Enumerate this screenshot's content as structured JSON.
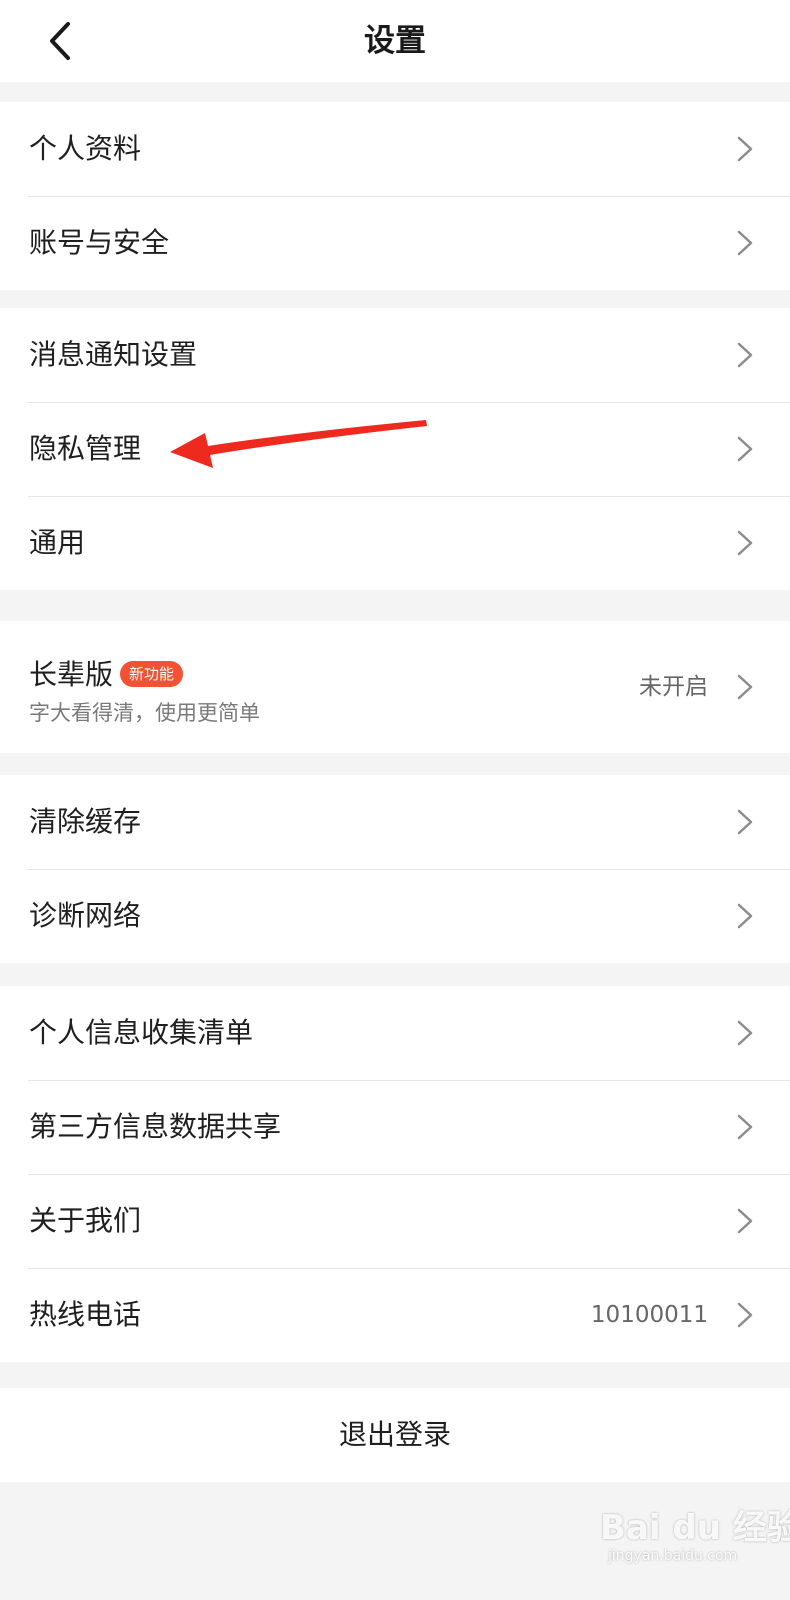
{
  "header": {
    "title": "设置",
    "back_icon": "chevron-left-icon"
  },
  "groups": [
    {
      "items": [
        {
          "label": "个人资料"
        },
        {
          "label": "账号与安全"
        }
      ]
    },
    {
      "items": [
        {
          "label": "消息通知设置"
        },
        {
          "label": "隐私管理"
        },
        {
          "label": "通用"
        }
      ]
    },
    {
      "elder": {
        "title": "长辈版",
        "badge": "新功能",
        "subtitle": "字大看得清，使用更简单",
        "value": "未开启"
      }
    },
    {
      "items": [
        {
          "label": "清除缓存"
        },
        {
          "label": "诊断网络"
        }
      ]
    },
    {
      "items": [
        {
          "label": "个人信息收集清单"
        },
        {
          "label": "第三方信息数据共享"
        },
        {
          "label": "关于我们"
        },
        {
          "label": "热线电话",
          "value": "10100011"
        }
      ]
    }
  ],
  "logout_label": "退出登录",
  "colors": {
    "badge": "#f25233",
    "annotation_arrow": "#ee2a1f",
    "background": "#f4f4f4"
  },
  "watermark": {
    "main": "Bai du 经验",
    "sub": "jingyan.baidu.com"
  }
}
